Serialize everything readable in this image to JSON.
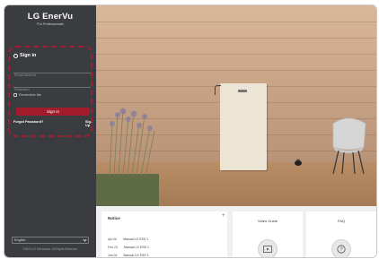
{
  "brand": {
    "logo": "LG EnerVu",
    "tagline": "For Professionals"
  },
  "signin": {
    "title": "Sign in",
    "email_placeholder": "Email Address",
    "password_placeholder": "Password",
    "remember_label": "Remember Me",
    "button_label": "Sign In",
    "forgot_label": "Forgot Password?",
    "signup_label": "Sign Up"
  },
  "footer": {
    "language": "English",
    "copyright": "©2023 LG Electronics. All Rights Reserved."
  },
  "notice": {
    "title": "Notice",
    "add_label": "+",
    "rows": [
      {
        "date": "Apr.06",
        "text": "Manual LG ESS 1"
      },
      {
        "date": "Feb.23",
        "text": "Manual LG ESS 1"
      },
      {
        "date": "Jan.04",
        "text": "Manual LG ESS 1"
      }
    ]
  },
  "video_guide": {
    "label": "Video Guide"
  },
  "faq": {
    "label": "FAQ"
  },
  "colors": {
    "sidebar": "#3a3c40",
    "accent": "#a31c2c",
    "highlight": "#a21c33"
  }
}
